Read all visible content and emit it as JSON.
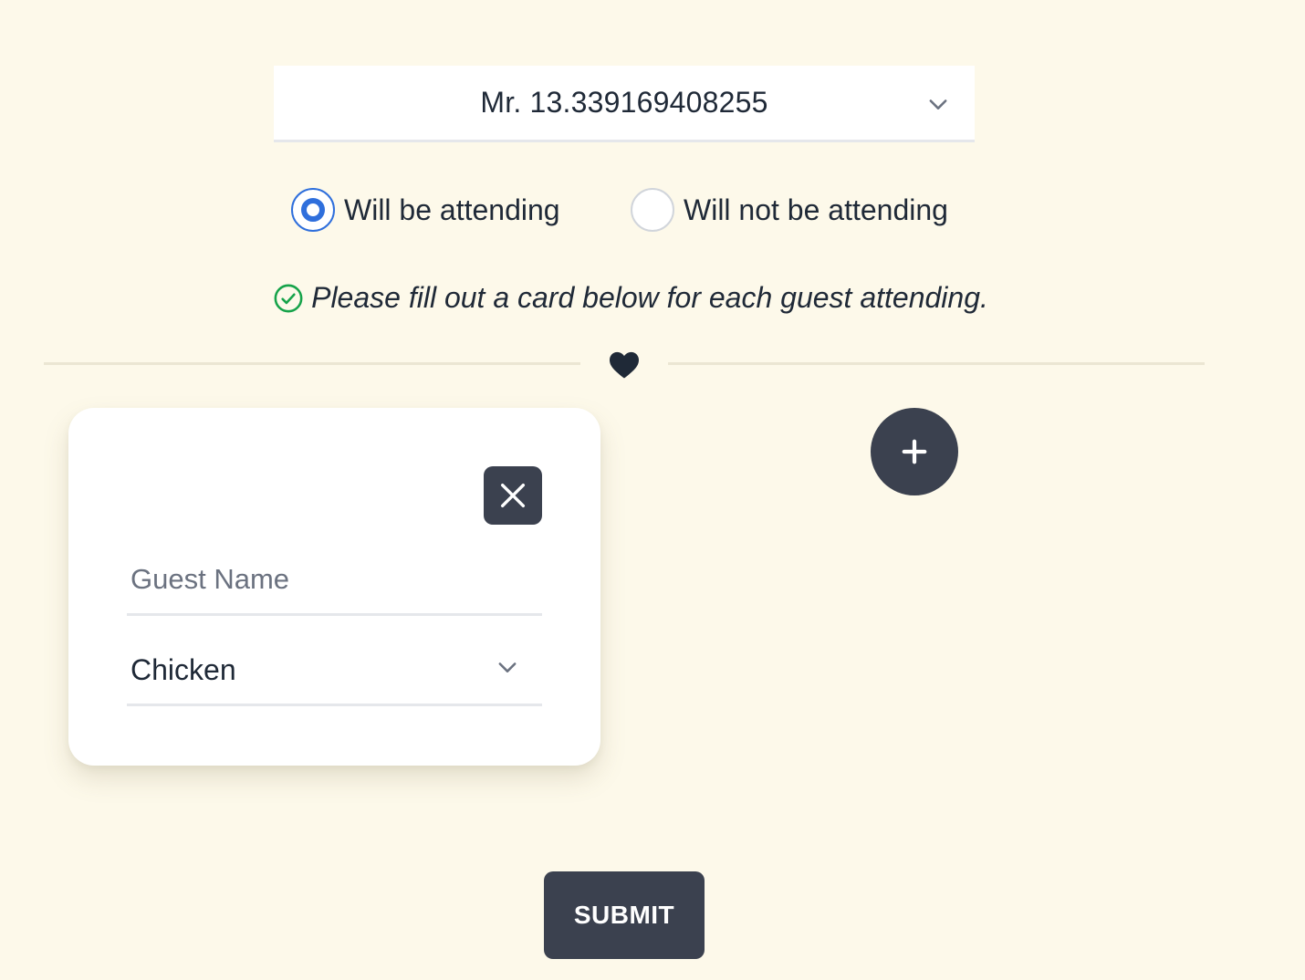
{
  "guest_select": {
    "selected": "Mr. 13.339169408255",
    "icon": "chevron-down-icon"
  },
  "attendance": {
    "options": [
      {
        "label": "Will be attending",
        "checked": true
      },
      {
        "label": "Will not be attending",
        "checked": false
      }
    ]
  },
  "info": {
    "icon": "check-circle-icon",
    "icon_color": "#16a34a",
    "text": "Please fill out a card below for each guest attending."
  },
  "divider": {
    "icon": "heart-icon"
  },
  "guest_cards": [
    {
      "remove_icon": "close-icon",
      "name_value": "",
      "name_placeholder": "Guest Name",
      "meal_selected": "Chicken"
    }
  ],
  "add_guest": {
    "icon": "plus-icon"
  },
  "submit_label": "SUBMIT",
  "colors": {
    "background": "#fdf9ea",
    "dark_button": "#3b414f",
    "radio_accent": "#2f6fdc"
  }
}
